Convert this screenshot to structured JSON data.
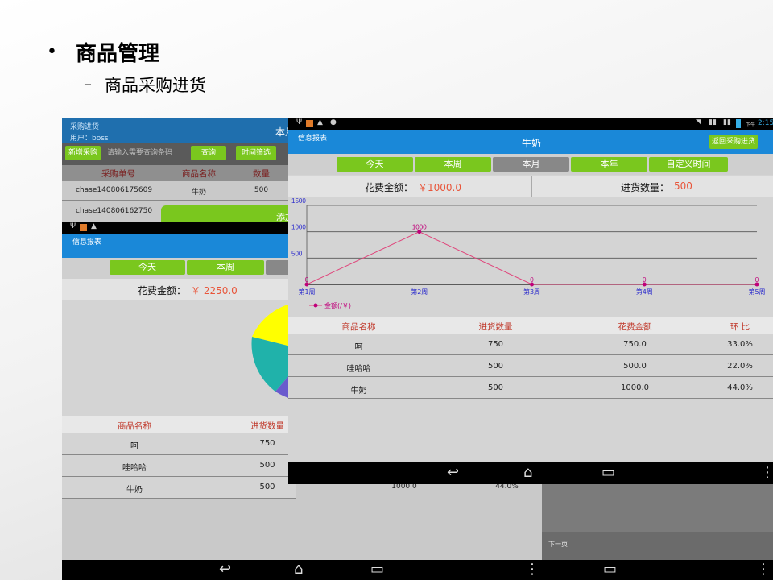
{
  "slide": {
    "bullet": "•",
    "title": "商品管理",
    "sub_dash": "–",
    "sub_title": "商品采购进货"
  },
  "screen_back": {
    "header_title": "采购进货",
    "header_user": "用户：boss",
    "header_right": "本月",
    "btn_add": "新增采购",
    "search_placeholder": "请输入需要查询条码",
    "btn_query": "查询",
    "btn_time": "时间筛选",
    "columns": [
      "采购单号",
      "商品名称",
      "数量"
    ],
    "rows": [
      [
        "chase140806175609",
        "牛奶",
        "500"
      ],
      [
        "chase140806162750",
        "",
        ""
      ]
    ],
    "add_overlay": "添加",
    "lower_rows": [
      [
        "1000.0",
        "44.0%"
      ]
    ],
    "next_page": "下一页"
  },
  "screen_mid": {
    "title": "信息报表",
    "tabs": [
      "今天",
      "本周",
      ""
    ],
    "total_label": "花费金额：",
    "total_value": "￥ 2250.0",
    "columns": [
      "商品名称",
      "进货数量"
    ],
    "rows": [
      [
        "呵",
        "750"
      ],
      [
        "哇哈哈",
        "500"
      ],
      [
        "牛奶",
        "500"
      ]
    ],
    "pie_colors": [
      "#ffff00",
      "#20b2aa",
      "#6a5acd"
    ]
  },
  "screen_front": {
    "status_time": "2:15",
    "status_ampm": "下午",
    "section_label": "信息报表",
    "title": "牛奶",
    "back_button": "返回采购进货",
    "tabs": [
      "今天",
      "本周",
      "本月",
      "本年",
      "自定义时间"
    ],
    "selected_tab": 2,
    "cost_label": "花费金额：",
    "cost_value": "￥1000.0",
    "qty_label": "进货数量：",
    "qty_value": "500",
    "legend": "金额(/￥)",
    "columns": [
      "商品名称",
      "进货数量",
      "花费金额",
      "环 比"
    ],
    "rows": [
      [
        "呵",
        "750",
        "750.0",
        "33.0%"
      ],
      [
        "哇哈哈",
        "500",
        "500.0",
        "22.0%"
      ],
      [
        "牛奶",
        "500",
        "1000.0",
        "44.0%"
      ]
    ]
  },
  "chart_data": {
    "type": "line",
    "categories": [
      "第1周",
      "第2周",
      "第3周",
      "第4周",
      "第5周"
    ],
    "series": [
      {
        "name": "金额(/￥)",
        "values": [
          0,
          1000,
          0,
          0,
          0
        ]
      }
    ],
    "y_ticks": [
      "1500",
      "1000",
      "500",
      "0"
    ],
    "ylim": [
      0,
      1500
    ],
    "data_labels": [
      "0",
      "1000",
      "0",
      "0",
      "0"
    ],
    "grid": true,
    "legend_position": "bottom-left",
    "colors": {
      "line": "#e0457b",
      "point": "#c0007a",
      "axis_text": "#2b2bcc"
    }
  }
}
